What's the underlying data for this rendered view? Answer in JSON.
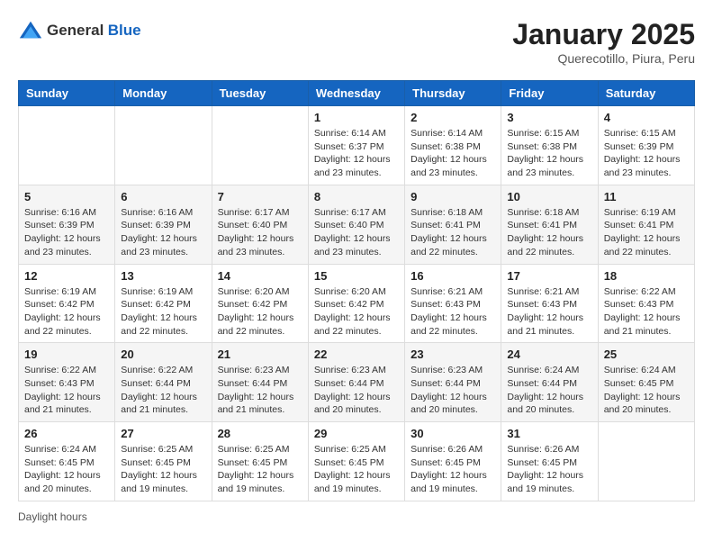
{
  "header": {
    "logo": {
      "text_general": "General",
      "text_blue": "Blue"
    },
    "title": "January 2025",
    "subtitle": "Querecotillo, Piura, Peru"
  },
  "days_of_week": [
    "Sunday",
    "Monday",
    "Tuesday",
    "Wednesday",
    "Thursday",
    "Friday",
    "Saturday"
  ],
  "weeks": [
    [
      {
        "day": "",
        "sunrise": "",
        "sunset": "",
        "daylight": ""
      },
      {
        "day": "",
        "sunrise": "",
        "sunset": "",
        "daylight": ""
      },
      {
        "day": "",
        "sunrise": "",
        "sunset": "",
        "daylight": ""
      },
      {
        "day": "1",
        "sunrise": "Sunrise: 6:14 AM",
        "sunset": "Sunset: 6:37 PM",
        "daylight": "Daylight: 12 hours and 23 minutes."
      },
      {
        "day": "2",
        "sunrise": "Sunrise: 6:14 AM",
        "sunset": "Sunset: 6:38 PM",
        "daylight": "Daylight: 12 hours and 23 minutes."
      },
      {
        "day": "3",
        "sunrise": "Sunrise: 6:15 AM",
        "sunset": "Sunset: 6:38 PM",
        "daylight": "Daylight: 12 hours and 23 minutes."
      },
      {
        "day": "4",
        "sunrise": "Sunrise: 6:15 AM",
        "sunset": "Sunset: 6:39 PM",
        "daylight": "Daylight: 12 hours and 23 minutes."
      }
    ],
    [
      {
        "day": "5",
        "sunrise": "Sunrise: 6:16 AM",
        "sunset": "Sunset: 6:39 PM",
        "daylight": "Daylight: 12 hours and 23 minutes."
      },
      {
        "day": "6",
        "sunrise": "Sunrise: 6:16 AM",
        "sunset": "Sunset: 6:39 PM",
        "daylight": "Daylight: 12 hours and 23 minutes."
      },
      {
        "day": "7",
        "sunrise": "Sunrise: 6:17 AM",
        "sunset": "Sunset: 6:40 PM",
        "daylight": "Daylight: 12 hours and 23 minutes."
      },
      {
        "day": "8",
        "sunrise": "Sunrise: 6:17 AM",
        "sunset": "Sunset: 6:40 PM",
        "daylight": "Daylight: 12 hours and 23 minutes."
      },
      {
        "day": "9",
        "sunrise": "Sunrise: 6:18 AM",
        "sunset": "Sunset: 6:41 PM",
        "daylight": "Daylight: 12 hours and 22 minutes."
      },
      {
        "day": "10",
        "sunrise": "Sunrise: 6:18 AM",
        "sunset": "Sunset: 6:41 PM",
        "daylight": "Daylight: 12 hours and 22 minutes."
      },
      {
        "day": "11",
        "sunrise": "Sunrise: 6:19 AM",
        "sunset": "Sunset: 6:41 PM",
        "daylight": "Daylight: 12 hours and 22 minutes."
      }
    ],
    [
      {
        "day": "12",
        "sunrise": "Sunrise: 6:19 AM",
        "sunset": "Sunset: 6:42 PM",
        "daylight": "Daylight: 12 hours and 22 minutes."
      },
      {
        "day": "13",
        "sunrise": "Sunrise: 6:19 AM",
        "sunset": "Sunset: 6:42 PM",
        "daylight": "Daylight: 12 hours and 22 minutes."
      },
      {
        "day": "14",
        "sunrise": "Sunrise: 6:20 AM",
        "sunset": "Sunset: 6:42 PM",
        "daylight": "Daylight: 12 hours and 22 minutes."
      },
      {
        "day": "15",
        "sunrise": "Sunrise: 6:20 AM",
        "sunset": "Sunset: 6:42 PM",
        "daylight": "Daylight: 12 hours and 22 minutes."
      },
      {
        "day": "16",
        "sunrise": "Sunrise: 6:21 AM",
        "sunset": "Sunset: 6:43 PM",
        "daylight": "Daylight: 12 hours and 22 minutes."
      },
      {
        "day": "17",
        "sunrise": "Sunrise: 6:21 AM",
        "sunset": "Sunset: 6:43 PM",
        "daylight": "Daylight: 12 hours and 21 minutes."
      },
      {
        "day": "18",
        "sunrise": "Sunrise: 6:22 AM",
        "sunset": "Sunset: 6:43 PM",
        "daylight": "Daylight: 12 hours and 21 minutes."
      }
    ],
    [
      {
        "day": "19",
        "sunrise": "Sunrise: 6:22 AM",
        "sunset": "Sunset: 6:43 PM",
        "daylight": "Daylight: 12 hours and 21 minutes."
      },
      {
        "day": "20",
        "sunrise": "Sunrise: 6:22 AM",
        "sunset": "Sunset: 6:44 PM",
        "daylight": "Daylight: 12 hours and 21 minutes."
      },
      {
        "day": "21",
        "sunrise": "Sunrise: 6:23 AM",
        "sunset": "Sunset: 6:44 PM",
        "daylight": "Daylight: 12 hours and 21 minutes."
      },
      {
        "day": "22",
        "sunrise": "Sunrise: 6:23 AM",
        "sunset": "Sunset: 6:44 PM",
        "daylight": "Daylight: 12 hours and 20 minutes."
      },
      {
        "day": "23",
        "sunrise": "Sunrise: 6:23 AM",
        "sunset": "Sunset: 6:44 PM",
        "daylight": "Daylight: 12 hours and 20 minutes."
      },
      {
        "day": "24",
        "sunrise": "Sunrise: 6:24 AM",
        "sunset": "Sunset: 6:44 PM",
        "daylight": "Daylight: 12 hours and 20 minutes."
      },
      {
        "day": "25",
        "sunrise": "Sunrise: 6:24 AM",
        "sunset": "Sunset: 6:45 PM",
        "daylight": "Daylight: 12 hours and 20 minutes."
      }
    ],
    [
      {
        "day": "26",
        "sunrise": "Sunrise: 6:24 AM",
        "sunset": "Sunset: 6:45 PM",
        "daylight": "Daylight: 12 hours and 20 minutes."
      },
      {
        "day": "27",
        "sunrise": "Sunrise: 6:25 AM",
        "sunset": "Sunset: 6:45 PM",
        "daylight": "Daylight: 12 hours and 19 minutes."
      },
      {
        "day": "28",
        "sunrise": "Sunrise: 6:25 AM",
        "sunset": "Sunset: 6:45 PM",
        "daylight": "Daylight: 12 hours and 19 minutes."
      },
      {
        "day": "29",
        "sunrise": "Sunrise: 6:25 AM",
        "sunset": "Sunset: 6:45 PM",
        "daylight": "Daylight: 12 hours and 19 minutes."
      },
      {
        "day": "30",
        "sunrise": "Sunrise: 6:26 AM",
        "sunset": "Sunset: 6:45 PM",
        "daylight": "Daylight: 12 hours and 19 minutes."
      },
      {
        "day": "31",
        "sunrise": "Sunrise: 6:26 AM",
        "sunset": "Sunset: 6:45 PM",
        "daylight": "Daylight: 12 hours and 19 minutes."
      },
      {
        "day": "",
        "sunrise": "",
        "sunset": "",
        "daylight": ""
      }
    ]
  ],
  "footer": {
    "daylight_label": "Daylight hours"
  }
}
